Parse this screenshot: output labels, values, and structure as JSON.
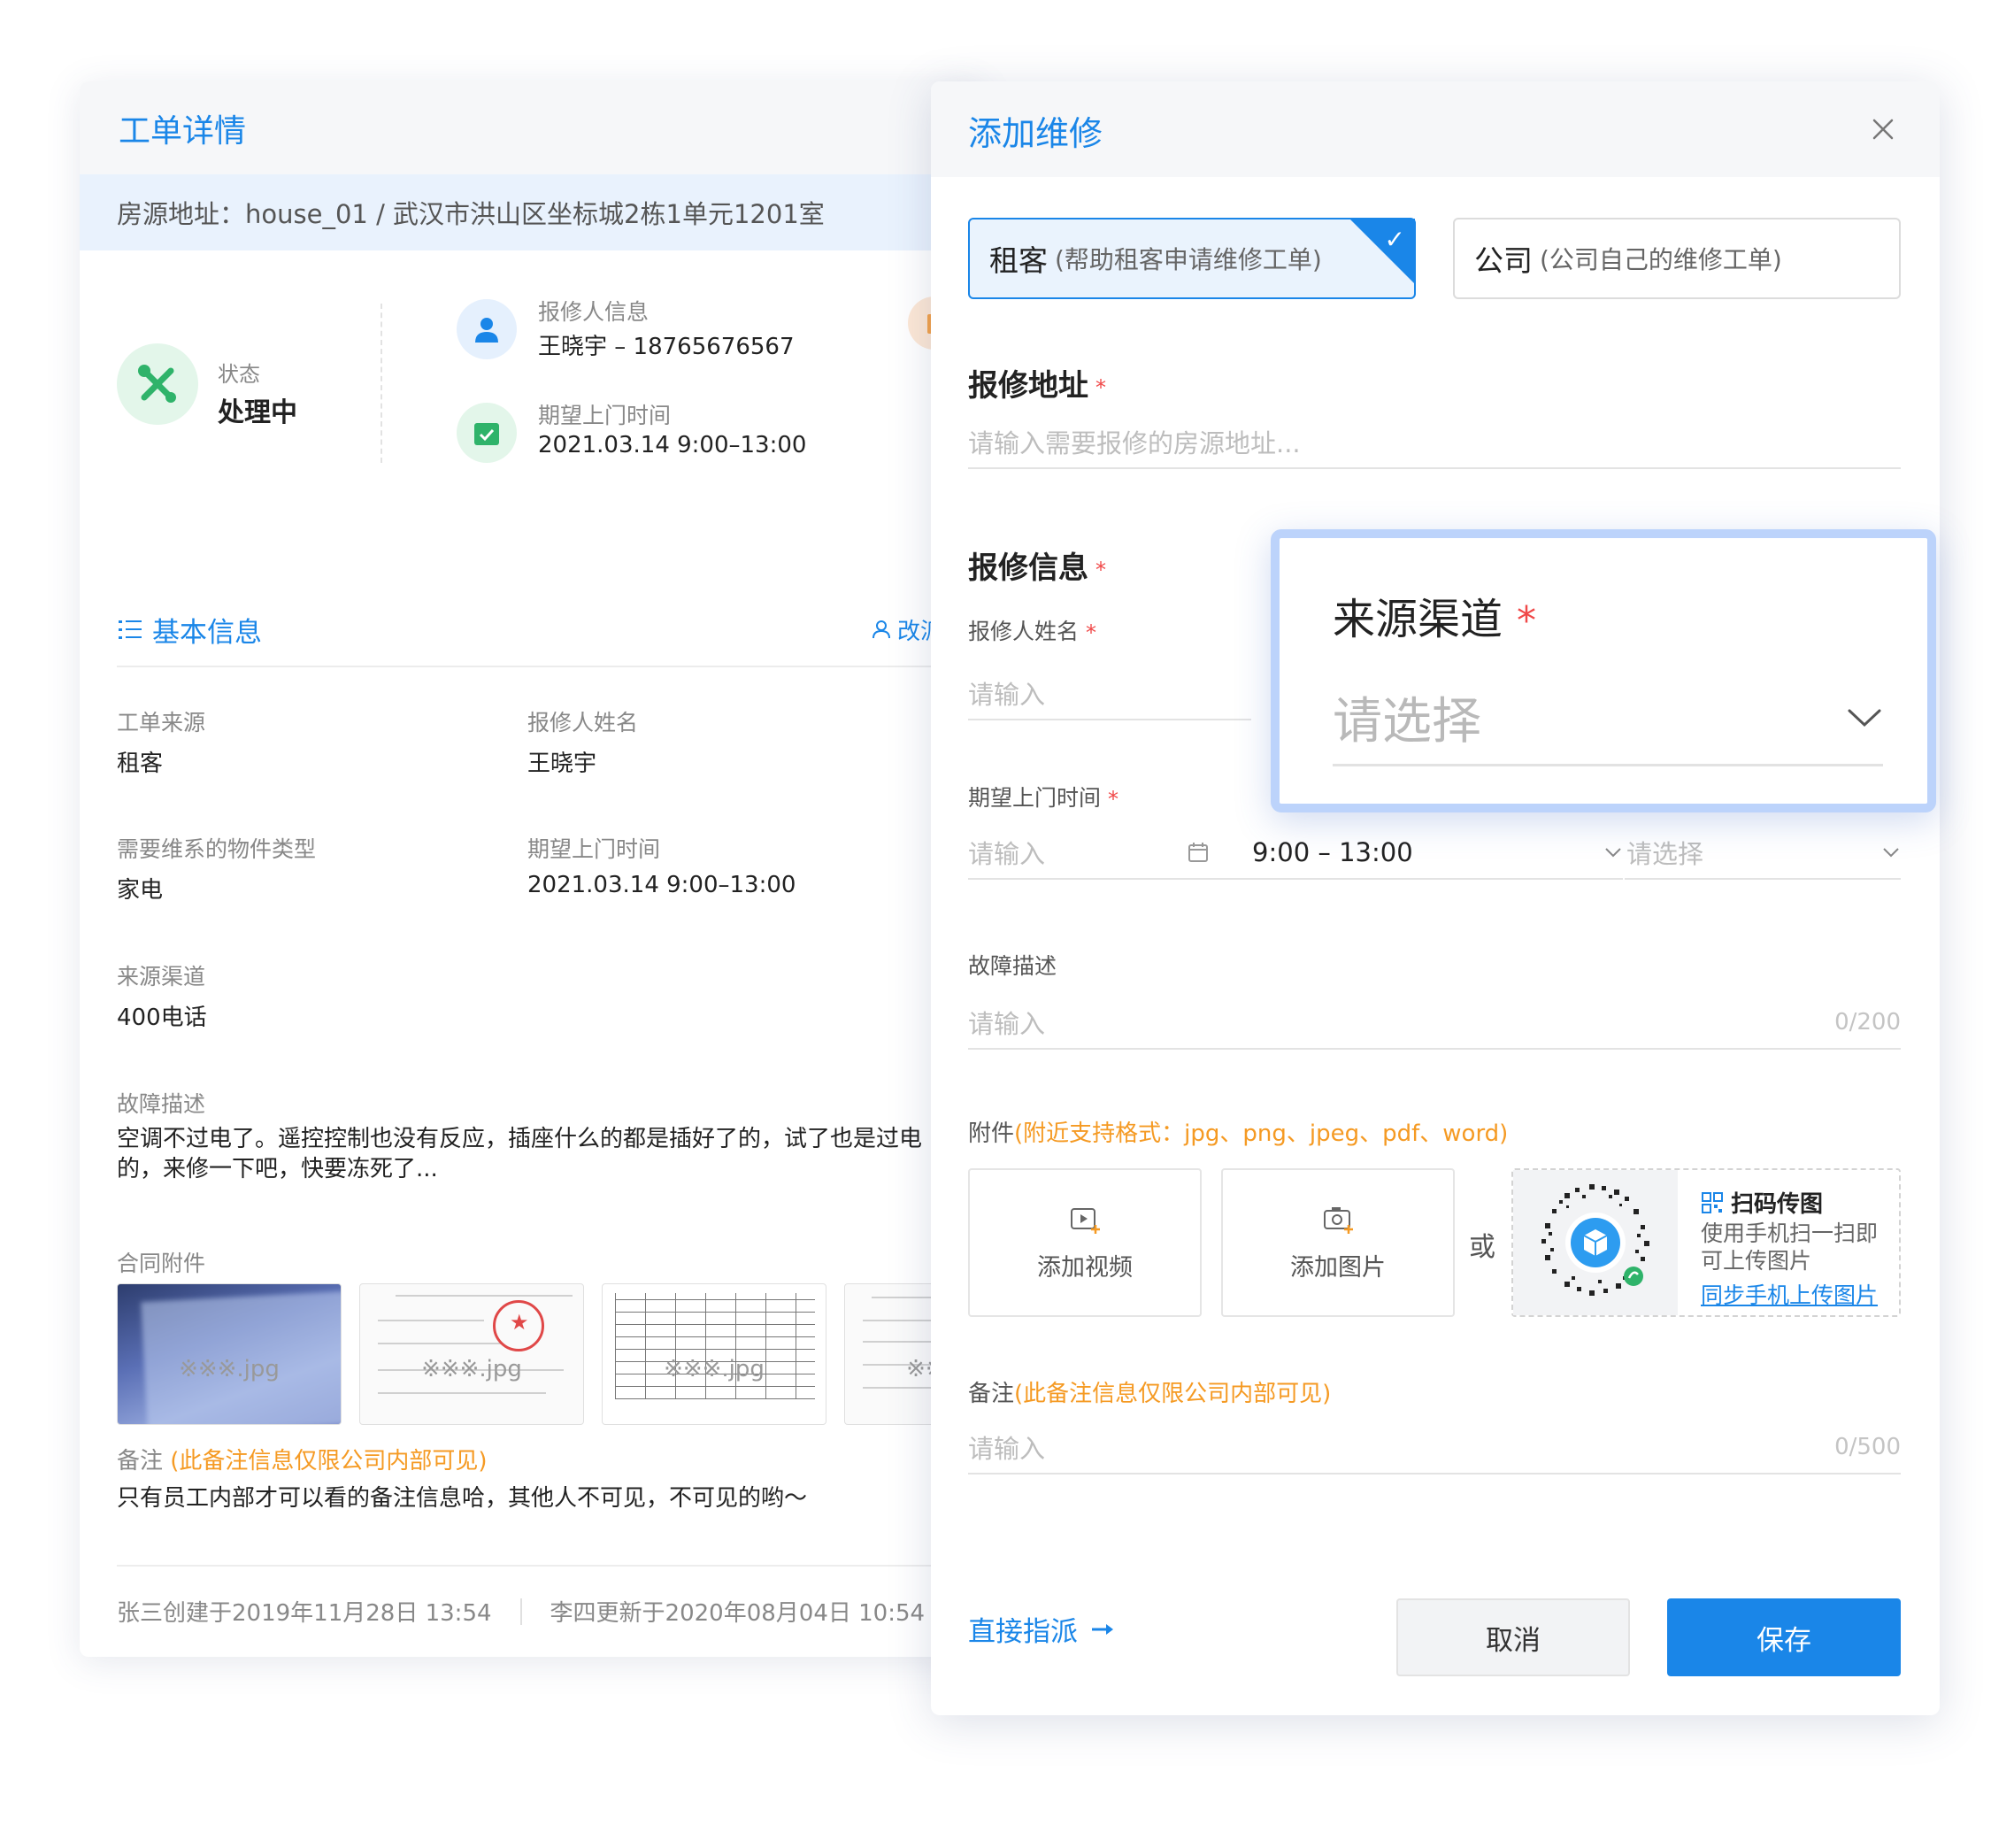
{
  "detail": {
    "title": "工单详情",
    "address": "房源地址：house_01 / 武汉市洪山区坐标城2栋1单元1201室",
    "status": {
      "label": "状态",
      "value": "处理中"
    },
    "reporter": {
      "label": "报修人信息",
      "value": "王晓宇 – 18765676567"
    },
    "visit": {
      "label": "期望上门时间",
      "value": "2021.03.14   9:00–13:00"
    },
    "section": {
      "title": "基本信息",
      "reassign": "改派"
    },
    "fields": {
      "source": {
        "label": "工单来源",
        "value": "租客"
      },
      "name": {
        "label": "报修人姓名",
        "value": "王晓宇"
      },
      "type": {
        "label": "需要维系的物件类型",
        "value": "家电"
      },
      "time": {
        "label": "期望上门时间",
        "value": "2021.03.14   9:00–13:00"
      },
      "channel": {
        "label": "来源渠道",
        "value": "400电话"
      },
      "fault": {
        "label": "故障描述",
        "value": "空调不过电了。遥控控制也没有反应，插座什么的都是插好了的，试了也是过电的，来修一下吧，快要冻死了..."
      },
      "contract": {
        "label": "合同附件"
      }
    },
    "attachments": [
      "※※※.jpg",
      "※※※.jpg",
      "※※※.jpg",
      "※※※.jpg"
    ],
    "remark": {
      "label": "备注",
      "note": "(此备注信息仅限公司内部可见)",
      "value": "只有员工内部才可以看的备注信息哈，其他人不可见，不可见的哟～"
    },
    "footer": {
      "created": "张三创建于2019年11月28日   13:54",
      "updated": "李四更新于2020年08月04日   10:54"
    }
  },
  "modal": {
    "title": "添加维修",
    "types": [
      {
        "label": "租客",
        "sub": "(帮助租客申请维修工单)",
        "selected": true
      },
      {
        "label": "公司",
        "sub": "(公司自己的维修工单)",
        "selected": false
      }
    ],
    "address": {
      "title": "报修地址",
      "placeholder": "请输入需要报修的房源地址..."
    },
    "info": {
      "title": "报修信息"
    },
    "reporter_name": {
      "label": "报修人姓名",
      "placeholder": "请输入"
    },
    "visit_time": {
      "label": "期望上门时间",
      "date_placeholder": "请输入",
      "range_value": "9:00 – 13:00",
      "select_placeholder": "请选择"
    },
    "fault": {
      "label": "故障描述",
      "placeholder": "请输入",
      "counter": "0/200"
    },
    "attach": {
      "label": "附件",
      "hint": "(附近支持格式：jpg、png、jpeg、pdf、word)",
      "add_video": "添加视频",
      "add_image": "添加图片",
      "or": "或",
      "qr_title": "扫码传图",
      "qr_desc": "使用手机扫一扫即可上传图片",
      "qr_link": "同步手机上传图片"
    },
    "remark": {
      "label": "备注",
      "note": "(此备注信息仅限公司内部可见)",
      "placeholder": "请输入",
      "counter": "0/500"
    },
    "direct_assign": "直接指派",
    "cancel": "取消",
    "save": "保存"
  },
  "popover": {
    "title": "来源渠道",
    "required": "*",
    "placeholder": "请选择"
  },
  "colors": {
    "accent": "#1a86e8",
    "warning": "#f59a23",
    "required": "#f04848",
    "success": "#2fb36a"
  }
}
